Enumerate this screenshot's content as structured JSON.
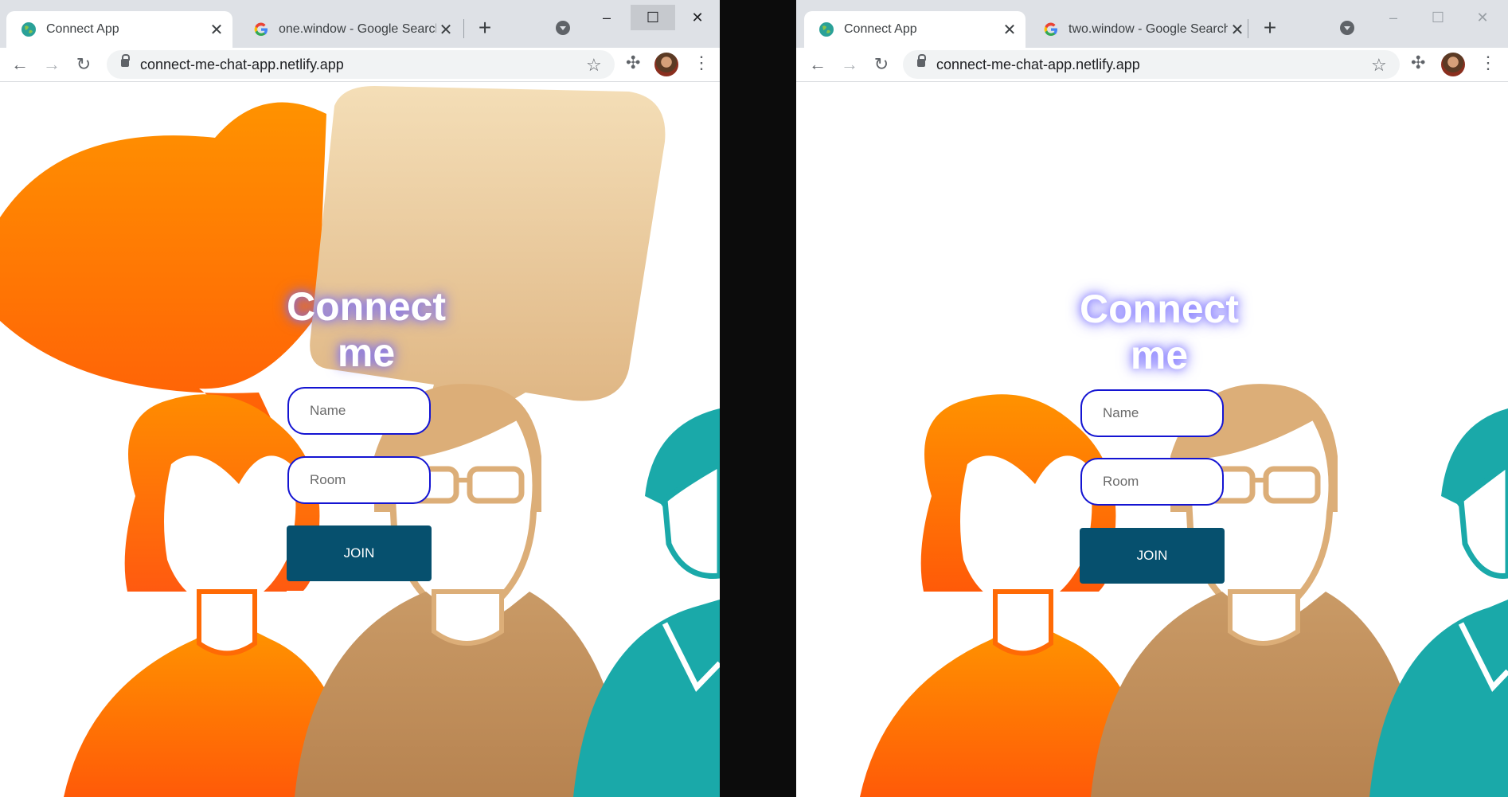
{
  "windows": [
    {
      "id": "left",
      "tabs": [
        {
          "title": "Connect App",
          "favicon": "globe-icon",
          "active": true
        },
        {
          "title": "one.window - Google Search",
          "favicon": "google-icon",
          "active": false
        }
      ],
      "window_controls": {
        "minimize": "–",
        "maximize": "☐",
        "close": "✕"
      },
      "url": "connect-me-chat-app.netlify.app",
      "app": {
        "title_line1": "Connect",
        "title_line2": "me",
        "name_placeholder": "Name",
        "room_placeholder": "Room",
        "join_label": "JOIN"
      }
    },
    {
      "id": "right",
      "tabs": [
        {
          "title": "Connect App",
          "favicon": "globe-icon",
          "active": true
        },
        {
          "title": "two.window - Google Search",
          "favicon": "google-icon",
          "active": false
        }
      ],
      "window_controls": {
        "minimize": "–",
        "maximize": "☐",
        "close": "✕"
      },
      "url": "connect-me-chat-app.netlify.app",
      "app": {
        "title_line1": "Connect",
        "title_line2": "me",
        "name_placeholder": "Name",
        "room_placeholder": "Room",
        "join_label": "JOIN"
      }
    }
  ],
  "icons": {
    "back": "←",
    "forward": "→",
    "reload": "↻",
    "star": "☆",
    "extensions": "✣",
    "menu": "⋮",
    "new_tab": "+",
    "tab_close": "✕"
  },
  "colors": {
    "accent_border": "#1414d2",
    "join_button": "#06506e",
    "glow": "#6e64ff",
    "orange": "#ff8a00",
    "tan": "#dcae78",
    "teal": "#1aa9a9"
  }
}
